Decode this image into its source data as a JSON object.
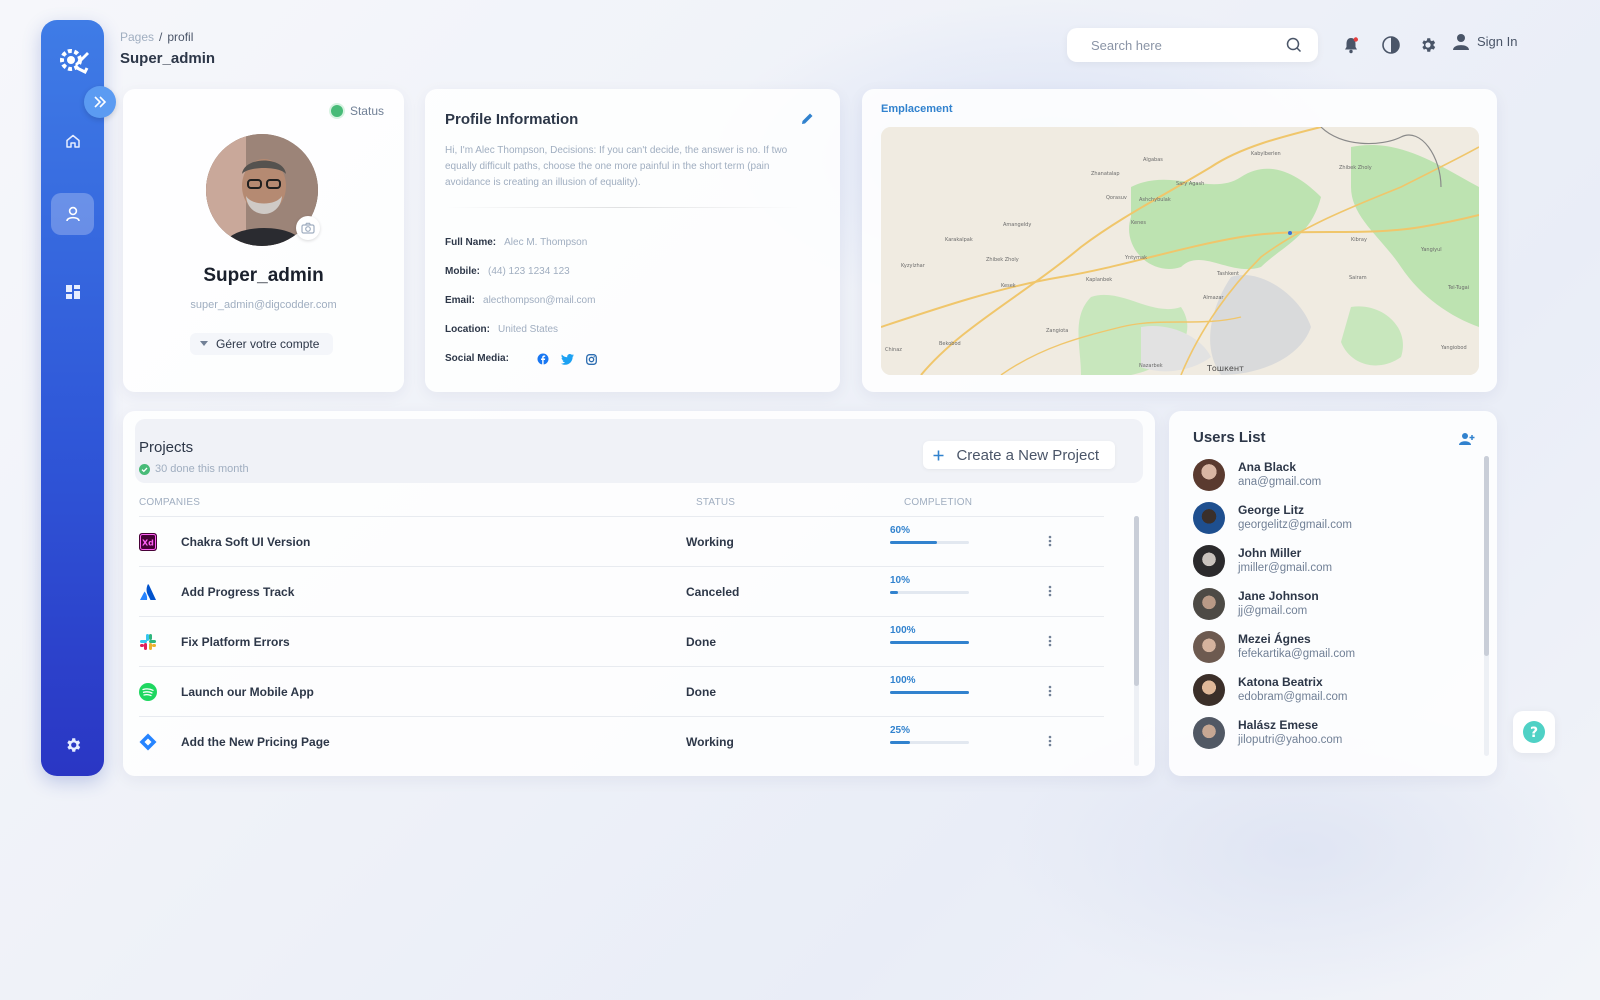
{
  "breadcrumb": {
    "root": "Pages",
    "separator": "/",
    "current": "profil"
  },
  "page_title": "Super_admin",
  "header": {
    "search_placeholder": "Search here",
    "sign_in": "Sign In",
    "icons": [
      "search-icon",
      "bell-icon",
      "contrast-icon",
      "gear-icon",
      "user-icon"
    ]
  },
  "sidebar": {
    "items": [
      {
        "name": "home",
        "icon": "home-icon",
        "active": false
      },
      {
        "name": "profile",
        "icon": "user-icon",
        "active": true
      },
      {
        "name": "dashboard",
        "icon": "grid-icon",
        "active": false
      },
      {
        "name": "settings",
        "icon": "gear-icon",
        "active": false
      }
    ]
  },
  "profile": {
    "status": "Status",
    "name": "Super_admin",
    "email": "super_admin@digcodder.com",
    "manage_label": "Gérer votre compte"
  },
  "profile_info": {
    "title": "Profile Information",
    "bio": "Hi, I'm Alec Thompson, Decisions: If you can't decide, the answer is no. If two equally difficult paths, choose the one more painful in the short term (pain avoidance is creating an illusion of equality).",
    "full_name_label": "Full Name:",
    "full_name": "Alec M. Thompson",
    "mobile_label": "Mobile:",
    "mobile": "(44) 123 1234 123",
    "email_label": "Email:",
    "email": "alecthompson@mail.com",
    "location_label": "Location:",
    "location": "United States",
    "social_label": "Social Media:"
  },
  "map": {
    "label": "Emplacement",
    "city": "Тошкент",
    "places": [
      "Zhanatalap",
      "Algabas",
      "Kabylberlen",
      "Zhibek Zholy",
      "Sary Agash",
      "Ashchybulak",
      "Amangeldy",
      "Karakalpak",
      "Yntymak",
      "Zhibek Zholy",
      "Tashkent",
      "Almazar",
      "Kenes",
      "Kaplanbek",
      "Kyzylzhar",
      "Kesek",
      "Sairam",
      "Chinaz",
      "Zangiota",
      "Kibray",
      "Bekobod",
      "Yangiobod",
      "Tel-Tugai",
      "Yangiyul",
      "Nazarbek",
      "Qorasuv"
    ]
  },
  "projects": {
    "title": "Projects",
    "subtitle": "30 done this month",
    "create_label": "Create a New Project",
    "columns": {
      "companies": "COMPANIES",
      "status": "STATUS",
      "completion": "COMPLETION"
    },
    "rows": [
      {
        "name": "Chakra Soft UI Version",
        "status": "Working",
        "completion_label": "60%",
        "completion": 60,
        "logo": "xd-icon"
      },
      {
        "name": "Add Progress Track",
        "status": "Canceled",
        "completion_label": "10%",
        "completion": 10,
        "logo": "atlassian-icon"
      },
      {
        "name": "Fix Platform Errors",
        "status": "Done",
        "completion_label": "100%",
        "completion": 100,
        "logo": "slack-icon"
      },
      {
        "name": "Launch our Mobile App",
        "status": "Done",
        "completion_label": "100%",
        "completion": 100,
        "logo": "spotify-icon"
      },
      {
        "name": "Add the New Pricing Page",
        "status": "Working",
        "completion_label": "25%",
        "completion": 25,
        "logo": "jira-icon"
      }
    ]
  },
  "users": {
    "title": "Users List",
    "list": [
      {
        "name": "Ana Black",
        "email": "ana@gmail.com"
      },
      {
        "name": "George Litz",
        "email": "georgelitz@gmail.com"
      },
      {
        "name": "John Miller",
        "email": "jmiller@gmail.com"
      },
      {
        "name": "Jane Johnson",
        "email": "jj@gmail.com"
      },
      {
        "name": "Mezei Ágnes",
        "email": "fefekartika@gmail.com"
      },
      {
        "name": "Katona Beatrix",
        "email": "edobram@gmail.com"
      },
      {
        "name": "Halász Emese",
        "email": "jiloputri@yahoo.com"
      }
    ]
  },
  "colors": {
    "accent": "#3182ce",
    "sidebar_top": "#3f7ce6",
    "sidebar_bottom": "#2a36c4",
    "status_green": "#48bb78",
    "help": "#4fd1c5"
  }
}
